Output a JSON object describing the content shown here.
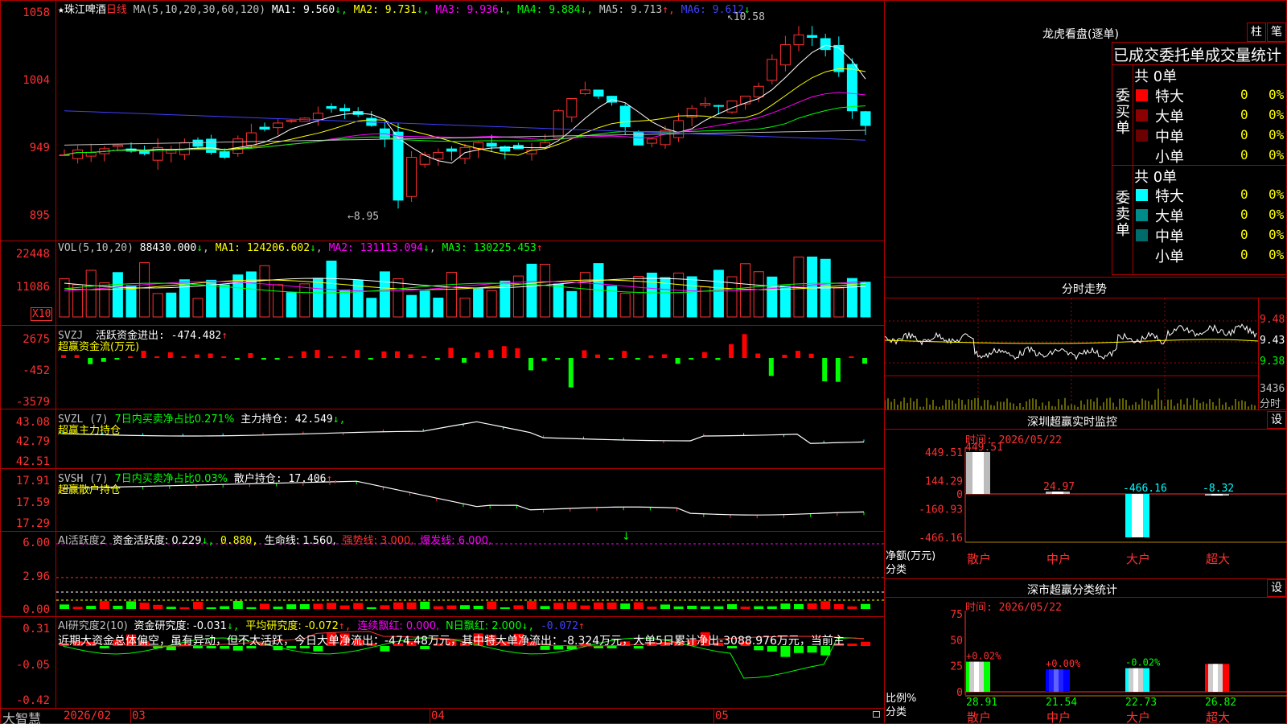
{
  "stock": {
    "name": "珠江啤酒",
    "star": "★",
    "period": "日线"
  },
  "main_panel": {
    "ma_label": "MA(5,10,20,30,60,120)",
    "ma_values": [
      {
        "label": "MA1:",
        "value": "9.560",
        "arrow": "↓",
        "color": "#ffffff"
      },
      {
        "label": "MA2:",
        "value": "9.731",
        "arrow": "↓",
        "color": "#ffff00"
      },
      {
        "label": "MA3:",
        "value": "9.936",
        "arrow": "↓",
        "color": "#ff00ff"
      },
      {
        "label": "MA4:",
        "value": "9.884",
        "arrow": "↓",
        "color": "#00ff00"
      },
      {
        "label": "MA5:",
        "value": "9.713",
        "arrow": "↑",
        "color": "#c0c0c0"
      },
      {
        "label": "MA6:",
        "value": "9.612",
        "arrow": "↓",
        "color": "#4040ff"
      }
    ],
    "y_labels": [
      "1058",
      "1004",
      "949",
      "895"
    ],
    "high_mark": "10.58",
    "low_mark": "8.95"
  },
  "vol_panel": {
    "title": "VOL(5,10,20)",
    "value": "88430.000",
    "value_arrow": "↓",
    "ma1": "MA1: 124206.602",
    "ma1_arrow": "↓",
    "ma2": "MA2: 131113.094",
    "ma2_arrow": "↓",
    "ma3": "MA3: 130225.453",
    "ma3_arrow": "↑",
    "y_labels": [
      "22448",
      "11086"
    ],
    "unit": "X10"
  },
  "svzj_panel": {
    "title": "SVZJ",
    "text": "活跃资金进出: -474.482",
    "arrow": "↑",
    "subtitle": "超赢资金流(万元)",
    "y_labels": [
      "2675",
      "-452",
      "-3579"
    ]
  },
  "svzl_panel": {
    "title": "SVZL (7)",
    "green_text": "7日内买卖净占比0.271%",
    "text": "主力持仓: 42.549",
    "arrow": "↓,",
    "subtitle": "超赢主力持仓",
    "y_labels": [
      "43.08",
      "42.79",
      "42.51"
    ]
  },
  "svsh_panel": {
    "title": "SVSH (7)",
    "green_text": "7日内买卖净占比0.03%",
    "text": "散户持仓: 17.406",
    "arrow": "↑,",
    "subtitle": "超赢散户持仓",
    "y_labels": [
      "17.91",
      "17.59",
      "17.29"
    ]
  },
  "ai_active_panel": {
    "title": "AI活跃度2",
    "text1": "资金活跃度: 0.229",
    "arrow1": "↓,",
    "text2": "0.880,",
    "text3": "生命线: 1.560,",
    "text4": "强势线: 3.000,",
    "text5": "爆发线: 6.000,",
    "y_labels": [
      "6.00",
      "2.96",
      "0.00"
    ]
  },
  "ai_research_panel": {
    "title": "AI研究度2(10)",
    "text1": "资金研究度: -0.031",
    "arrow1": "↓,",
    "text2": "平均研究度: -0.072",
    "arrow2": "↑,",
    "text3": "连续飘红: 0.000,",
    "text4": "N日飘红: 2.000",
    "arrow4": "↓,",
    "text5": "-0.072",
    "arrow5": "↑",
    "comment": "近期大资金总体偏空，虽有异动，但不太活跃，今日大单净流出：-474.48万元，其中特大单净流出：-8.324万元，大单5日累计净出-3088.976万元，当前主",
    "y_labels": [
      "0.31",
      "-0.05",
      "-0.42"
    ]
  },
  "bottom_bar": {
    "brand": "大智慧",
    "dates": [
      "2026/02",
      "03",
      "04",
      "05"
    ]
  },
  "longhu": {
    "title": "龙虎看盘(逐单)",
    "btn1": "柱",
    "btn2": "笔",
    "header": "已成交委托单成交量统计",
    "buy_side": "委买单",
    "sell_side": "委卖单",
    "buy_total": "共 0单",
    "sell_total": "共 0单",
    "buy_rows": [
      {
        "label": "特大",
        "value": "0",
        "pct": "0%",
        "color": "#ff0000"
      },
      {
        "label": "大单",
        "value": "0",
        "pct": "0%",
        "color": "#8b0000"
      },
      {
        "label": "中单",
        "value": "0",
        "pct": "0%",
        "color": "#6b0000"
      },
      {
        "label": "小单",
        "value": "0",
        "pct": "0%",
        "color": ""
      }
    ],
    "sell_rows": [
      {
        "label": "特大",
        "value": "0",
        "pct": "0%",
        "color": "#00ffff"
      },
      {
        "label": "大单",
        "value": "0",
        "pct": "0%",
        "color": "#008b8b"
      },
      {
        "label": "中单",
        "value": "0",
        "pct": "0%",
        "color": "#006b6b"
      },
      {
        "label": "小单",
        "value": "0",
        "pct": "0%",
        "color": ""
      }
    ]
  },
  "intraday": {
    "title": "分时走势",
    "price_labels": [
      "9.48",
      "9.43",
      "9.38"
    ],
    "vol_label": "3436",
    "vol_unit": "分时"
  },
  "monitor": {
    "title": "深圳超赢实时监控",
    "btn": "设",
    "time_label": "时间: 2026/05/22",
    "y_labels": [
      "449.51",
      "144.29",
      "0",
      "-160.93",
      "-466.16"
    ],
    "axis_label1": "净额(万元)",
    "axis_label2": "分类",
    "categories": [
      "散户",
      "中户",
      "大户",
      "超大"
    ],
    "values": [
      449.51,
      24.97,
      -466.16,
      -8.32
    ],
    "value_labels": [
      "449.51",
      "24.97",
      "-466.16",
      "-8.32"
    ]
  },
  "classify": {
    "title": "深市超赢分类统计",
    "btn": "设",
    "time_label": "时间: 2026/05/22",
    "y_labels": [
      "75",
      "50",
      "25",
      "0"
    ],
    "axis_label1": "比例%",
    "axis_label2": "分类",
    "categories": [
      "散户",
      "中户",
      "大户",
      "超大"
    ],
    "values": [
      28.91,
      21.54,
      22.73,
      26.82
    ],
    "changes": [
      "+0.02%",
      "+0.00%",
      "-0.02%",
      ""
    ],
    "bar_colors": [
      "#00ff00",
      "#0000ff",
      "#00ffff",
      "#ff0000"
    ]
  },
  "chart_data": {
    "type": "bar",
    "title": "深圳超赢实时监控",
    "categories": [
      "散户",
      "中户",
      "大户",
      "超大"
    ],
    "series": [
      {
        "name": "净额(万元)",
        "values": [
          449.51,
          24.97,
          -466.16,
          -8.32
        ]
      }
    ],
    "ylim": [
      -466.16,
      449.51
    ]
  }
}
